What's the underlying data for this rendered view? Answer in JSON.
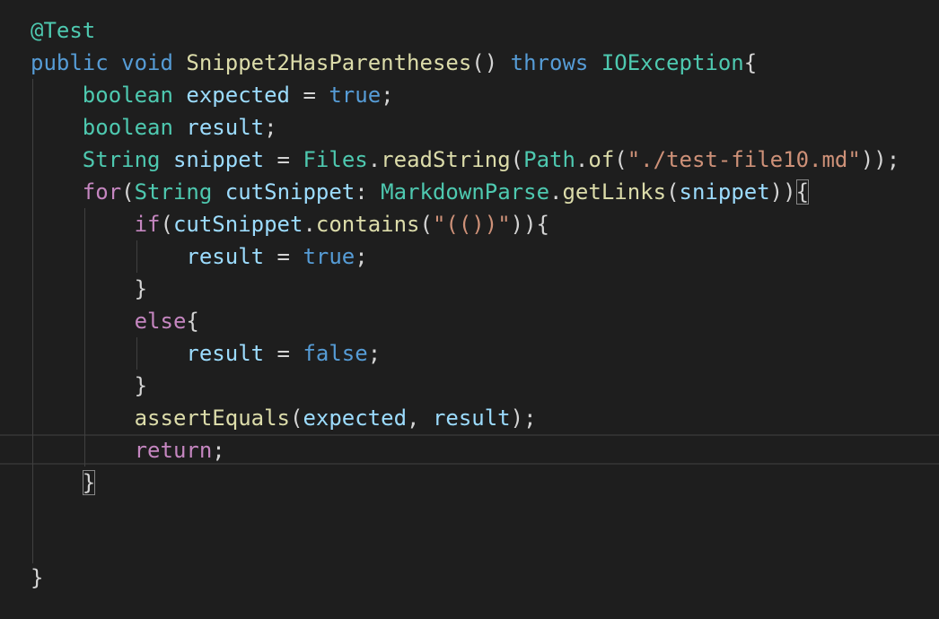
{
  "colors": {
    "background": "#1e1e1e",
    "keyword": "#569cd6",
    "control_keyword": "#c586c0",
    "type": "#4ec9b0",
    "function": "#dcdcaa",
    "variable": "#9cdcfe",
    "string": "#ce9178",
    "punctuation": "#d4d4d4",
    "indent_guide": "#404040",
    "current_line_border": "#303030",
    "bracket_match_border": "#888888"
  },
  "code": {
    "line1": {
      "annotation": "@Test"
    },
    "line2": {
      "kw_public": "public",
      "kw_void": "void",
      "method_name": "Snippet2HasParentheses",
      "parens": "()",
      "kw_throws": "throws",
      "exception": "IOException",
      "open_brace": "{"
    },
    "line3": {
      "type": "boolean",
      "var": "expected",
      "op": " = ",
      "value": "true",
      "end": ";"
    },
    "line4": {
      "type": "boolean",
      "var": "result",
      "end": ";"
    },
    "line5": {
      "type": "String",
      "var": "snippet",
      "op": " = ",
      "cls_files": "Files",
      "dot1": ".",
      "fn_read": "readString",
      "paren1": "(",
      "cls_path": "Path",
      "dot2": ".",
      "fn_of": "of",
      "paren2": "(",
      "str": "\"./test-file10.md\"",
      "end": "));"
    },
    "line6": {
      "kw_for": "for",
      "paren_open": "(",
      "type": "String",
      "var": "cutSnippet",
      "colon": ": ",
      "cls": "MarkdownParse",
      "dot": ".",
      "fn": "getLinks",
      "paren2": "(",
      "arg": "snippet",
      "close": "))",
      "brace": "{"
    },
    "line7": {
      "kw_if": "if",
      "paren_open": "(",
      "var": "cutSnippet",
      "dot": ".",
      "fn": "contains",
      "paren2": "(",
      "str": "\"(())\"",
      "close": ")){"
    },
    "line8": {
      "var": "result",
      "op": " = ",
      "value": "true",
      "end": ";"
    },
    "line9": {
      "brace": "}"
    },
    "line10": {
      "kw_else": "else",
      "brace": "{"
    },
    "line11": {
      "var": "result",
      "op": " = ",
      "value": "false",
      "end": ";"
    },
    "line12": {
      "brace": "}"
    },
    "line13": {
      "fn": "assertEquals",
      "paren_open": "(",
      "arg1": "expected",
      "comma": ", ",
      "arg2": "result",
      "end": ");"
    },
    "line14": {
      "kw_return": "return",
      "end": ";"
    },
    "line15": {
      "brace": "}"
    },
    "line16": {
      "brace": "}"
    }
  }
}
